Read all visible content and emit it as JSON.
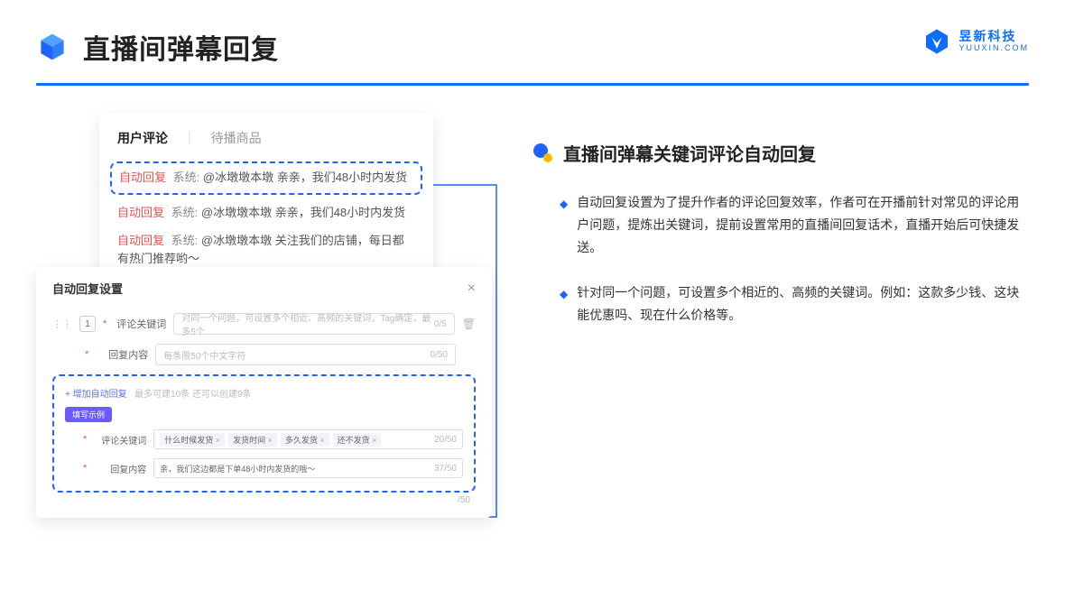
{
  "header": {
    "title": "直播间弹幕回复",
    "brand_name": "昱新科技",
    "brand_url": "YUUXIN.COM"
  },
  "comments": {
    "tab_active": "用户评论",
    "tab_inactive": "待播商品",
    "rows": [
      {
        "tag": "自动回复",
        "sys": "系统:",
        "text": "@冰墩墩本墩 亲亲，我们48小时内发货"
      },
      {
        "tag": "自动回复",
        "sys": "系统:",
        "text": "@冰墩墩本墩 亲亲，我们48小时内发货"
      },
      {
        "tag": "自动回复",
        "sys": "系统:",
        "text": "@冰墩墩本墩 关注我们的店铺，每日都有热门推荐哟～"
      }
    ]
  },
  "settings": {
    "title": "自动回复设置",
    "seq": "1",
    "label_keyword": "评论关键词",
    "placeholder_keyword": "对同一个问题，可设置多个相近、高频的关键词，Tag确定，最多5个",
    "counter_keyword": "0/5",
    "label_content": "回复内容",
    "placeholder_content": "每条限50个中文字符",
    "counter_content": "0/50",
    "add_link": "+ 增加自动回复",
    "add_hint": "最多可建10条 还可以创建9条",
    "example_badge": "填写示例",
    "ex_label_kw": "评论关键词",
    "chips": [
      "什么时候发货",
      "发货时间",
      "多久发货",
      "还不发货"
    ],
    "ex_kw_counter": "20/50",
    "ex_label_content": "回复内容",
    "ex_content_value": "亲，我们这边都是下单48小时内发货的哦～",
    "ex_content_counter": "37/50",
    "outer_counter": "/50"
  },
  "right": {
    "heading": "直播间弹幕关键词评论自动回复",
    "bullets": [
      "自动回复设置为了提升作者的评论回复效率，作者可在开播前针对常见的评论用户问题，提炼出关键词，提前设置常用的直播间回复话术，直播开始后可快捷发送。",
      "针对同一个问题，可设置多个相近的、高频的关键词。例如：这款多少钱、这块能优惠吗、现在什么价格等。"
    ]
  }
}
